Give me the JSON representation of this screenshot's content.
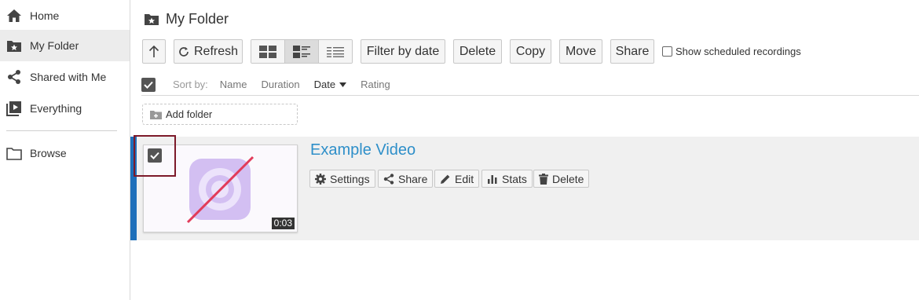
{
  "sidebar": {
    "items": [
      {
        "label": "Home",
        "icon": "home-icon"
      },
      {
        "label": "My Folder",
        "icon": "starred-folder-icon"
      },
      {
        "label": "Shared with Me",
        "icon": "share-icon"
      },
      {
        "label": "Everything",
        "icon": "play-library-icon"
      },
      {
        "label": "Browse",
        "icon": "folder-icon"
      }
    ]
  },
  "header": {
    "title": "My Folder"
  },
  "toolbar": {
    "up_icon": "arrow-up-icon",
    "refresh_label": "Refresh",
    "filter_label": "Filter by date",
    "delete_label": "Delete",
    "copy_label": "Copy",
    "move_label": "Move",
    "share_label": "Share",
    "show_scheduled_label": "Show scheduled recordings"
  },
  "sort": {
    "label": "Sort by:",
    "options": [
      "Name",
      "Duration",
      "Date",
      "Rating"
    ],
    "active": "Date"
  },
  "add_folder": {
    "label": "Add folder"
  },
  "video": {
    "title": "Example Video",
    "duration": "0:03",
    "actions": {
      "settings": "Settings",
      "share": "Share",
      "edit": "Edit",
      "stats": "Stats",
      "delete": "Delete"
    }
  },
  "colors": {
    "accent": "#1e6fba",
    "link": "#2e8fc9",
    "selection_outline": "#7d1a2a",
    "row_background": "#f0f0f0"
  }
}
